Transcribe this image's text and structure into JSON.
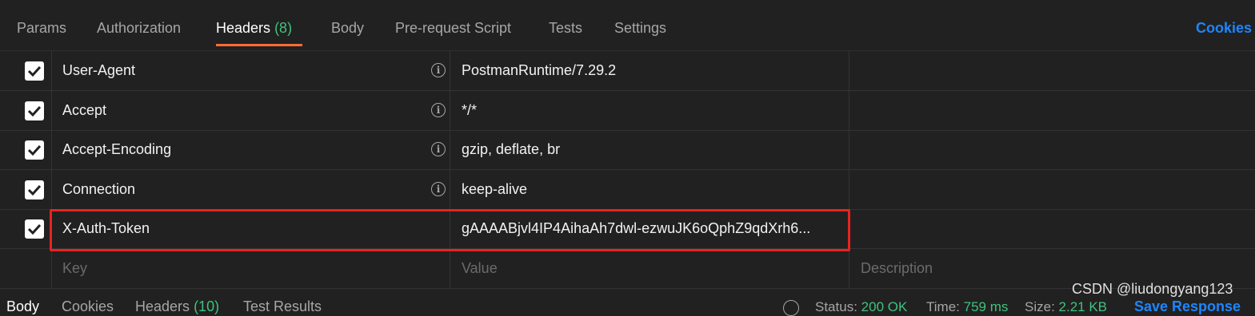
{
  "tabs": [
    {
      "label": "Params"
    },
    {
      "label": "Authorization"
    },
    {
      "label": "Headers",
      "count": "(8)"
    },
    {
      "label": "Body"
    },
    {
      "label": "Pre-request Script"
    },
    {
      "label": "Tests"
    },
    {
      "label": "Settings"
    }
  ],
  "cookies_label": "Cookies",
  "headers": [
    {
      "key": "User-Agent",
      "value": "PostmanRuntime/7.29.2",
      "checked": true
    },
    {
      "key": "Accept",
      "value": "*/*",
      "checked": true
    },
    {
      "key": "Accept-Encoding",
      "value": "gzip, deflate, br",
      "checked": true
    },
    {
      "key": "Connection",
      "value": "keep-alive",
      "checked": true
    },
    {
      "key": "X-Auth-Token",
      "value": "gAAAABjvl4IP4AihaAh7dwl-ezwuJK6oQphZ9qdXrh6...",
      "checked": true
    }
  ],
  "new_row": {
    "key_placeholder": "Key",
    "value_placeholder": "Value",
    "description_placeholder": "Description"
  },
  "response": {
    "tabs": [
      {
        "label": "Body"
      },
      {
        "label": "Cookies"
      },
      {
        "label": "Headers",
        "count": "(10)"
      },
      {
        "label": "Test Results"
      }
    ],
    "status_label": "Status:",
    "status_value": "200 OK",
    "time_label": "Time:",
    "time_value": "759 ms",
    "size_label": "Size:",
    "size_value": "2.21 KB",
    "save_label": "Save Response"
  },
  "watermark": "CSDN @liudongyang123",
  "colors": {
    "accent_orange": "#ff6c37",
    "link_blue": "#1d86ff",
    "count_green": "#3ec37d",
    "highlight_red": "#e8231f"
  }
}
